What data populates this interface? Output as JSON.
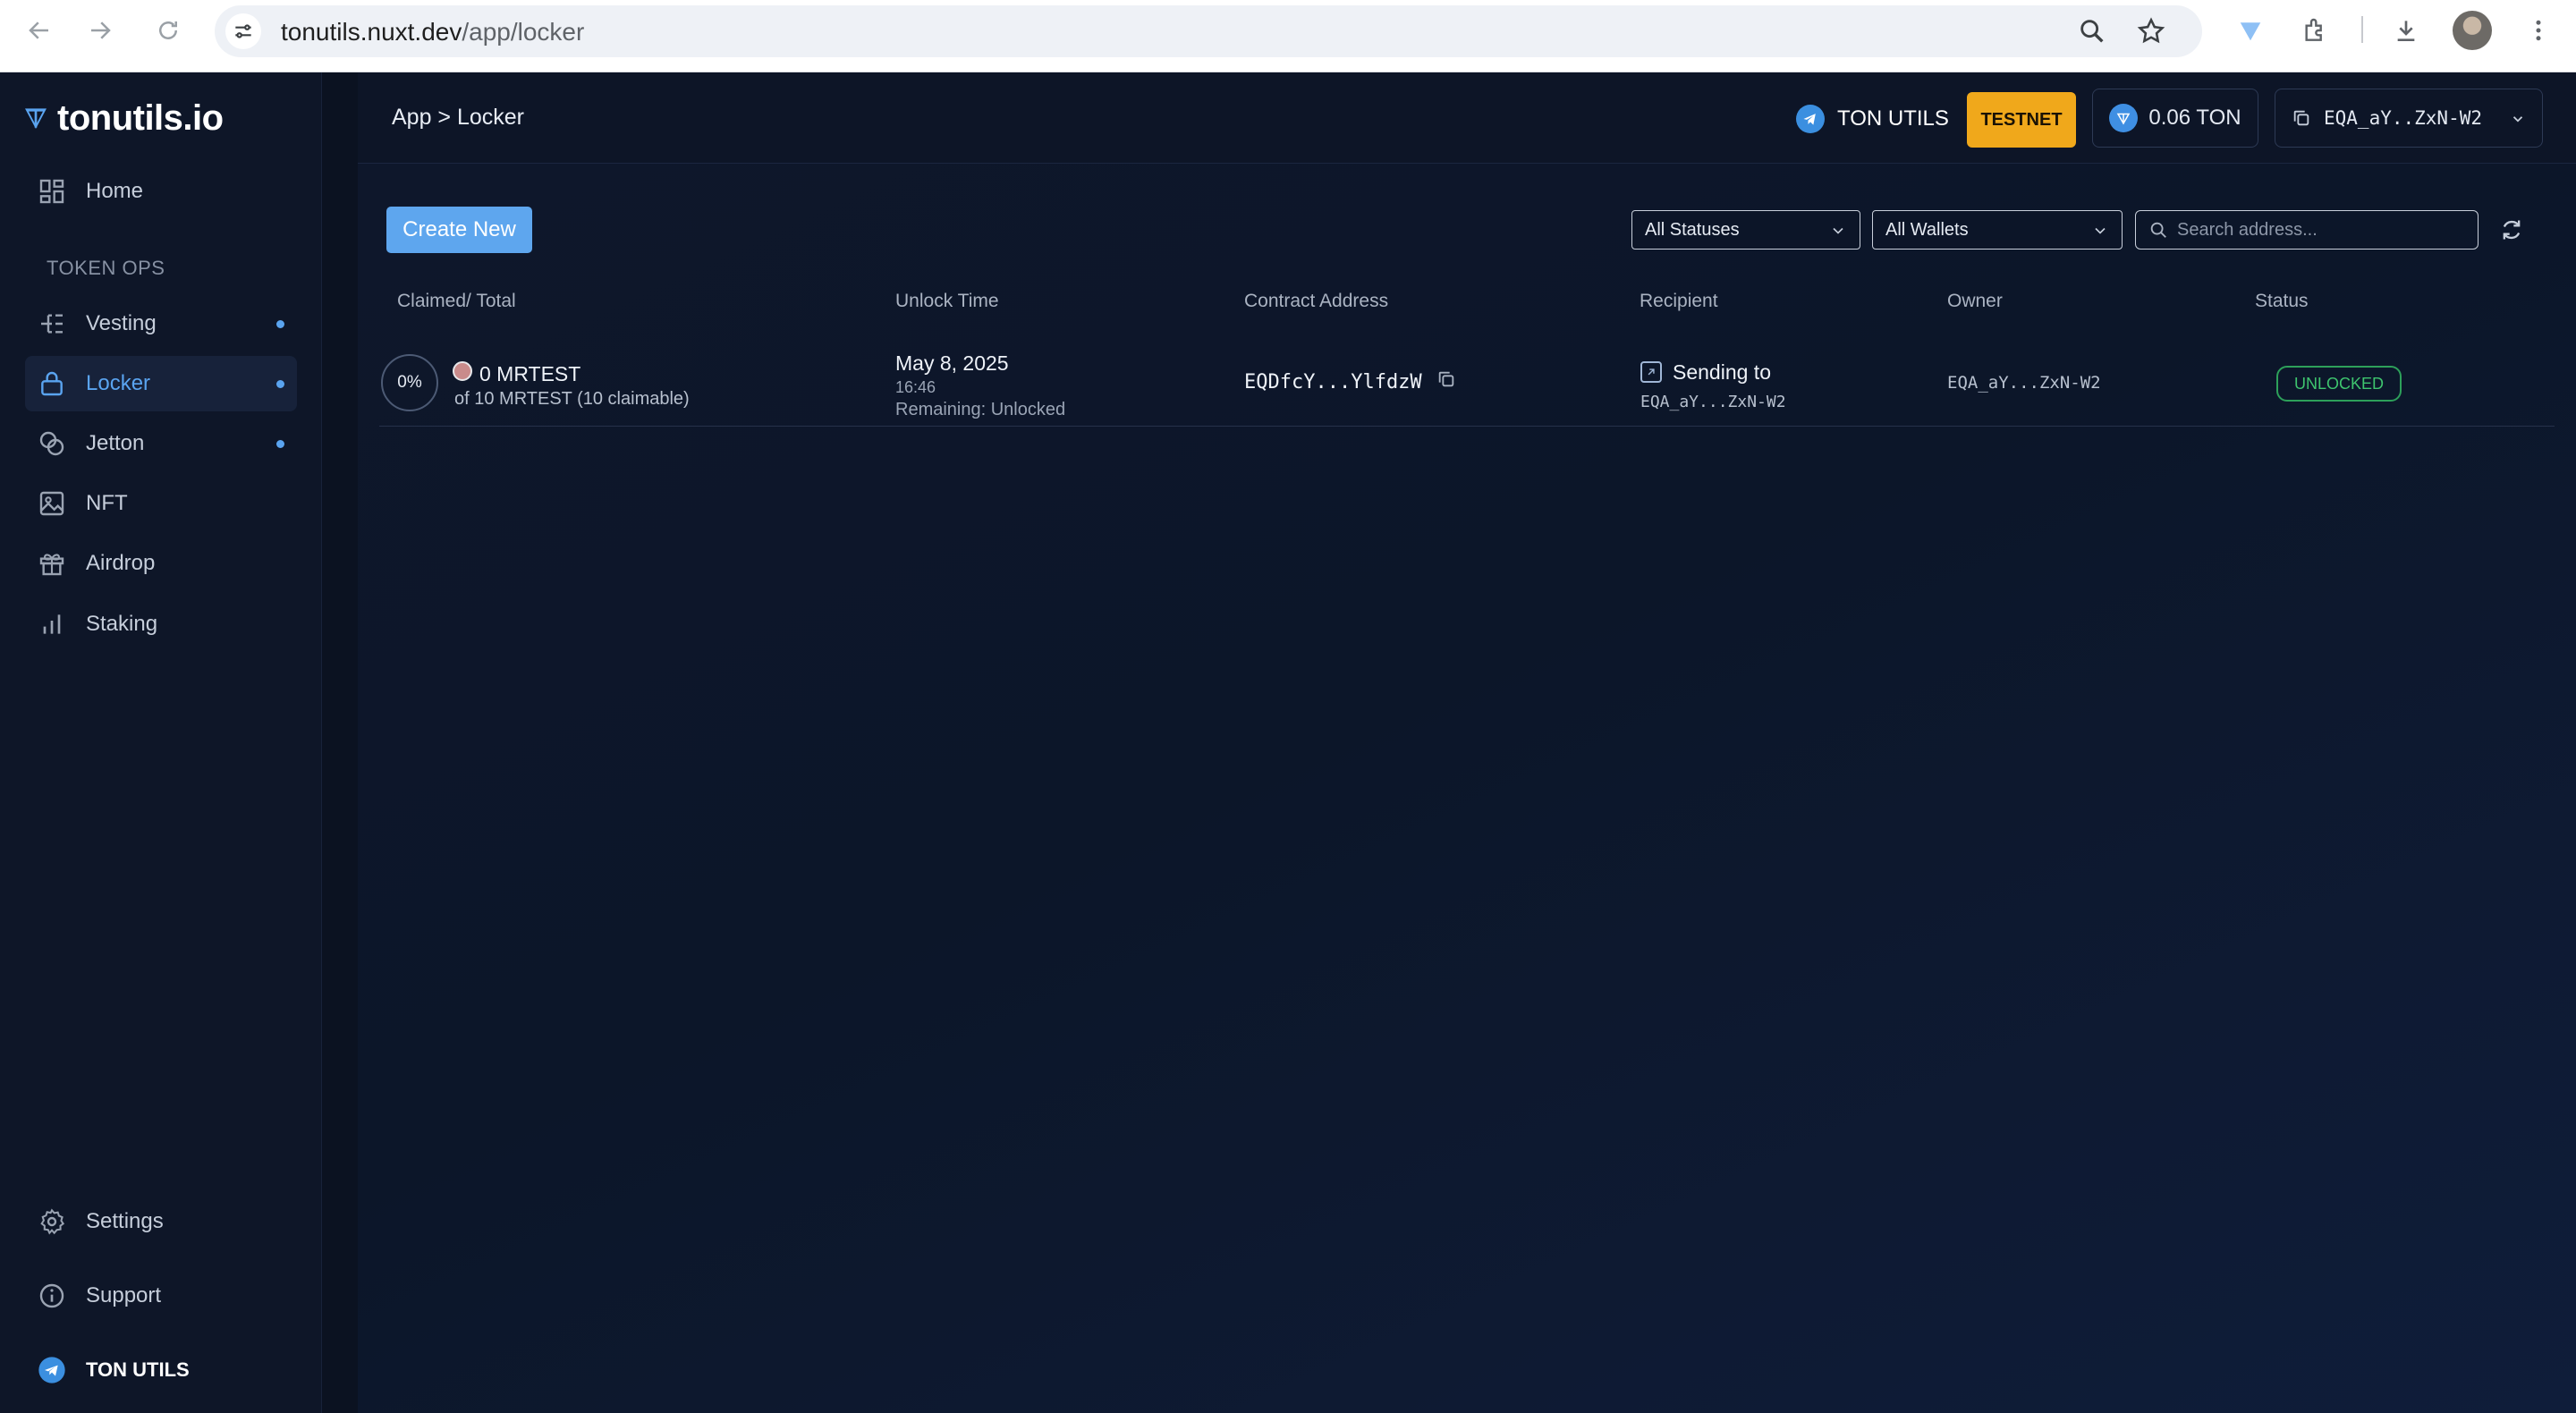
{
  "browser": {
    "url_host": "tonutils.nuxt.dev",
    "url_path": "/app/locker"
  },
  "sidebar": {
    "logo": "tonutils.io",
    "home": "Home",
    "section_label": "TOKEN OPS",
    "items": [
      {
        "label": "Vesting"
      },
      {
        "label": "Locker"
      },
      {
        "label": "Jetton"
      },
      {
        "label": "NFT"
      },
      {
        "label": "Airdrop"
      },
      {
        "label": "Staking"
      }
    ],
    "settings": "Settings",
    "support": "Support",
    "ton_utils": "TON UTILS"
  },
  "topbar": {
    "breadcrumb": "App > Locker",
    "telegram_label": "TON UTILS",
    "network_badge": "TESTNET",
    "balance": "0.06 TON",
    "wallet": "EQA_aY..ZxN-W2"
  },
  "toolbar": {
    "create_label": "Create New",
    "status_filter": "All Statuses",
    "wallet_filter": "All Wallets",
    "search_placeholder": "Search address..."
  },
  "table": {
    "headers": {
      "claimed": "Claimed/ Total",
      "unlock": "Unlock Time",
      "contract": "Contract Address",
      "recipient": "Recipient",
      "owner": "Owner",
      "status": "Status"
    },
    "rows": [
      {
        "percent": "0%",
        "amount": "0 MRTEST",
        "total": "of 10 MRTEST (10 claimable)",
        "unlock_date": "May 8, 2025",
        "unlock_time": "16:46",
        "remaining": "Remaining: Unlocked",
        "contract": "EQDfcY...YlfdzW",
        "recipient_label": "Sending to",
        "recipient_addr": "EQA_aY...ZxN-W2",
        "owner": "EQA_aY...ZxN-W2",
        "status": "UNLOCKED"
      }
    ]
  },
  "colors": {
    "accent": "#5aa4f0",
    "testnet": "#f0a81b",
    "status_unlocked": "#3ec46e",
    "background": "#0b1221"
  }
}
